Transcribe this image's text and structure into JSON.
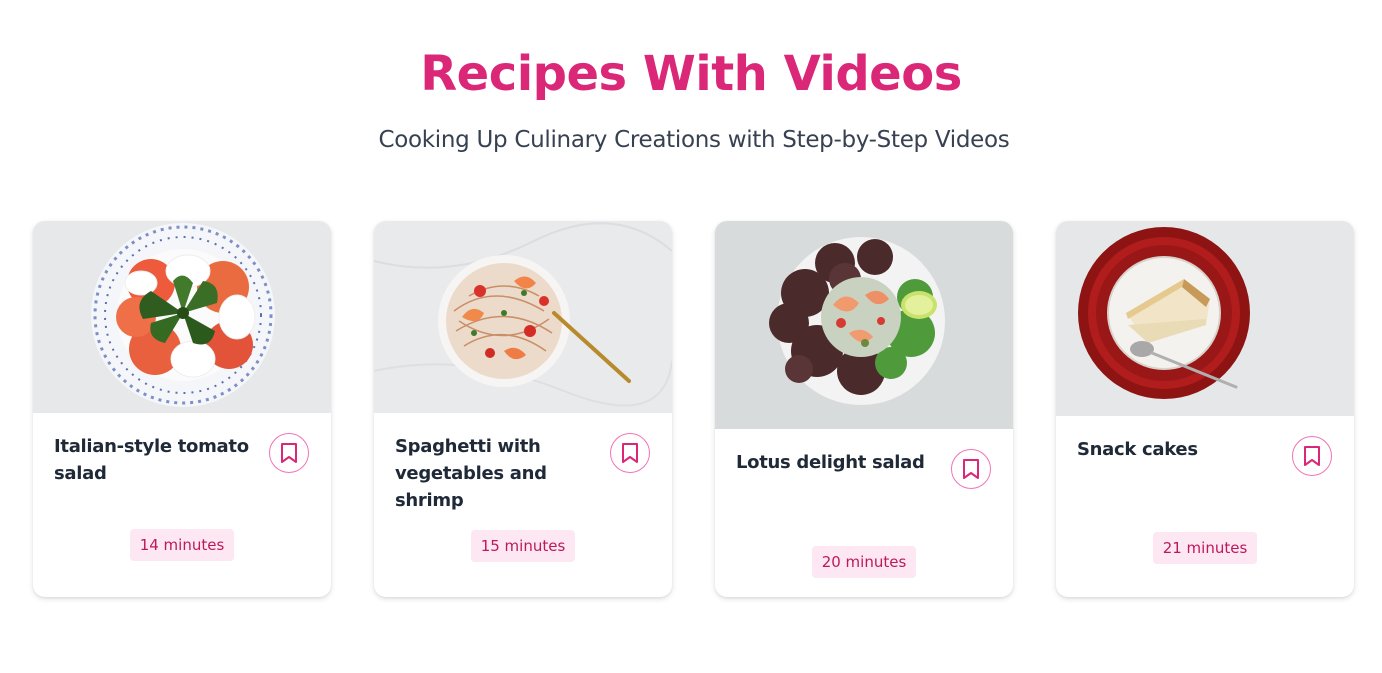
{
  "header": {
    "title": "Recipes With Videos",
    "subtitle": "Cooking Up Culinary Creations with Step-by-Step Videos"
  },
  "recipes": [
    {
      "title": "Italian-style tomato salad",
      "duration": "14 minutes",
      "image_icon": "tomato-mozzarella-salad-image"
    },
    {
      "title": "Spaghetti with vegetables and shrimp",
      "duration": "15 minutes",
      "image_icon": "spaghetti-shrimp-image"
    },
    {
      "title": "Lotus delight salad",
      "duration": "20 minutes",
      "image_icon": "seafood-salad-image"
    },
    {
      "title": "Snack cakes",
      "duration": "21 minutes",
      "image_icon": "cake-slice-image"
    }
  ],
  "colors": {
    "accent": "#db2777",
    "badge_bg": "#fce7f3",
    "badge_text": "#be185d",
    "bookmark_border": "#f472b6"
  },
  "icons": {
    "bookmark": "bookmark-icon"
  }
}
